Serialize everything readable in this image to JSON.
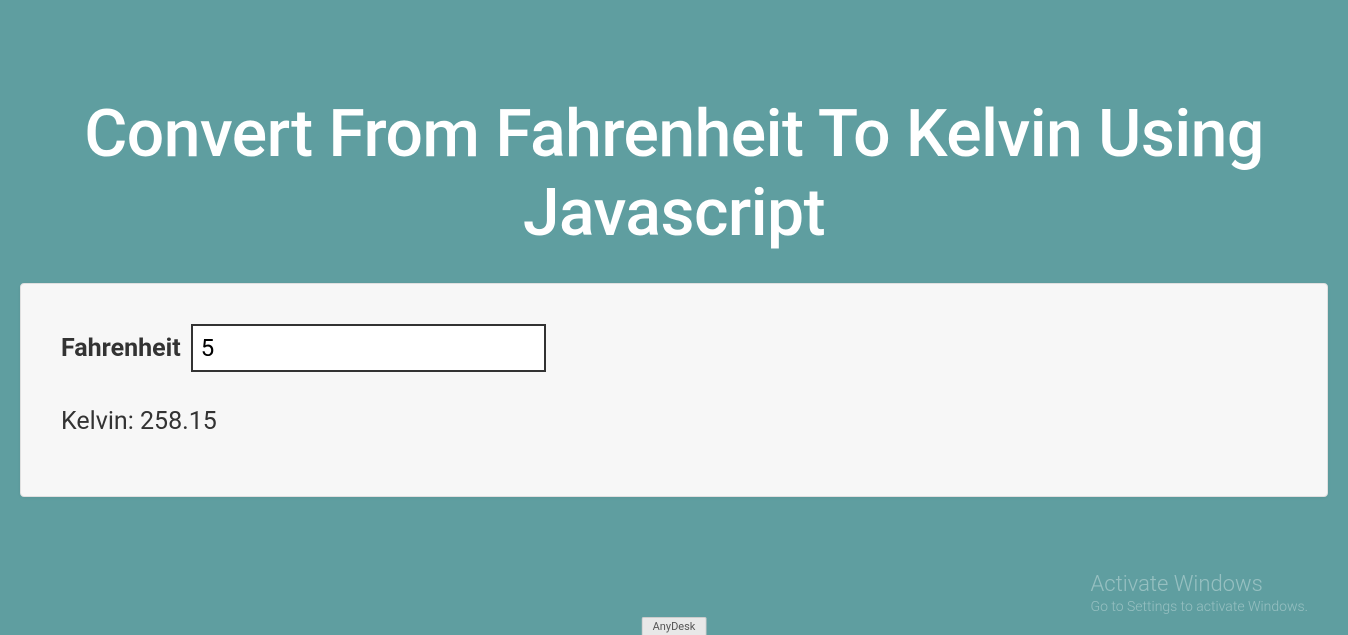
{
  "header": {
    "title": "Convert From Fahrenheit To Kelvin Using Javascript"
  },
  "form": {
    "input_label": "Fahrenheit",
    "input_value": "5",
    "result_prefix": "Kelvin: ",
    "result_value": "258.15"
  },
  "watermark": {
    "title": "Activate Windows",
    "subtitle": "Go to Settings to activate Windows."
  },
  "bottom_tab": {
    "label": "AnyDesk"
  }
}
